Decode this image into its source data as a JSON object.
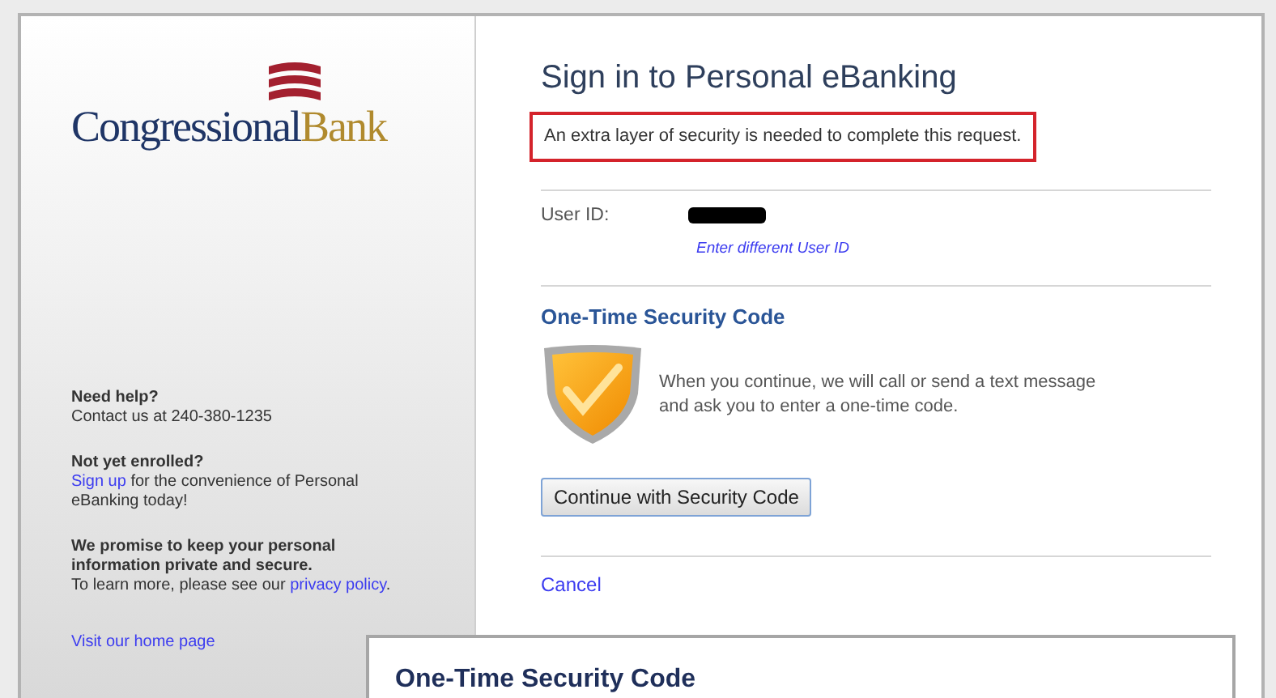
{
  "logo": {
    "name_first": "Congressional",
    "name_second": "Bank"
  },
  "sidebar": [
    {
      "heading": "Need help?",
      "text": "Contact us at 240-380-1235"
    },
    {
      "heading": "Not yet enrolled?",
      "link": "Sign up",
      "text": "for the convenience of Personal eBanking today!"
    },
    {
      "heading": "We promise to keep your personal information private and secure.",
      "text": "To learn more, please see our",
      "link_after": "privacy policy",
      "after": "."
    }
  ],
  "home_link": "Visit our home page",
  "title": "Sign in to Personal eBanking",
  "alert": "An extra layer of security is needed to complete this request.",
  "user_id": {
    "label": "User ID:",
    "redacted": true,
    "change_link": "Enter different User ID"
  },
  "section": {
    "title": "One-Time Security Code",
    "text": "When you continue, we will call or send a text message and ask you to enter a one-time code.",
    "button": "Continue with Security Code"
  },
  "cancel": "Cancel",
  "dialog": {
    "title": "One-Time Security Code"
  }
}
